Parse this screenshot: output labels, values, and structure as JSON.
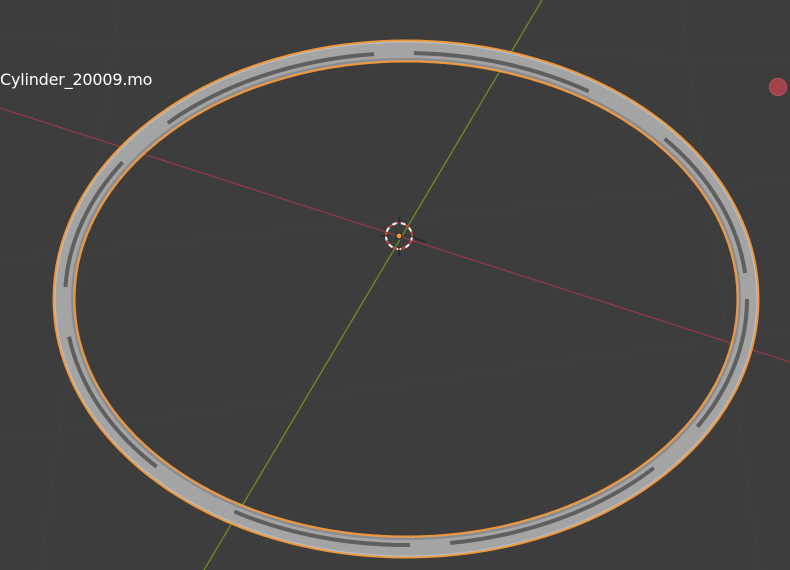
{
  "viewport": {
    "object_name": "Cylinder_20009.mo",
    "background_color": "#3d3d3d",
    "x_axis_color": "#8f3b44",
    "y_axis_color": "#6b8e23",
    "selection_outline_color": "#f0963a",
    "mesh_color": "#9e9e9e",
    "gizmo_x_color": "#b0414c",
    "cursor_icon": "3d-cursor-icon",
    "origin_icon": "object-origin-icon"
  }
}
